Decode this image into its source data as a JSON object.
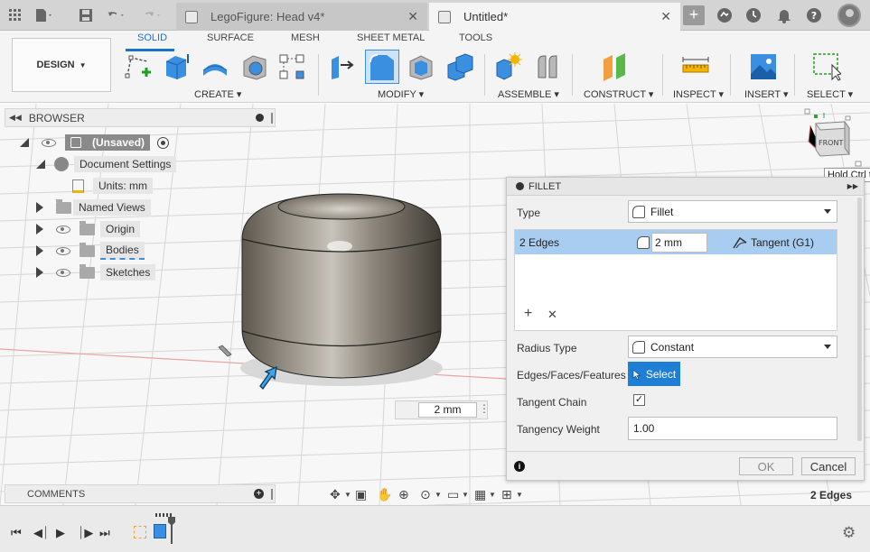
{
  "tabs": [
    {
      "label": "LegoFigure: Head v4*",
      "active": false
    },
    {
      "label": "Untitled*",
      "active": true
    }
  ],
  "toolbar": {
    "design_label": "DESIGN",
    "workspaces": [
      "SOLID",
      "SURFACE",
      "MESH",
      "SHEET METAL",
      "TOOLS"
    ],
    "groups": [
      "CREATE",
      "MODIFY",
      "ASSEMBLE",
      "CONSTRUCT",
      "INSPECT",
      "INSERT",
      "SELECT"
    ]
  },
  "browser": {
    "title": "BROWSER",
    "items": [
      {
        "label": "(Unsaved)"
      },
      {
        "label": "Document Settings"
      },
      {
        "label": "Units: mm"
      },
      {
        "label": "Named Views"
      },
      {
        "label": "Origin"
      },
      {
        "label": "Bodies"
      },
      {
        "label": "Sketches"
      }
    ]
  },
  "comments": {
    "label": "COMMENTS"
  },
  "viewcube": {
    "face_label": "FRONT",
    "tooltip": "Hold Ctrl t"
  },
  "dialog": {
    "title": "FILLET",
    "type_label": "Type",
    "type_value": "Fillet",
    "edges_label": "2 Edges",
    "edges_radius": "2 mm",
    "edges_continuity": "Tangent (G1)",
    "radius_type_label": "Radius Type",
    "radius_type_value": "Constant",
    "faces_label": "Edges/Faces/Features",
    "select_button": "Select",
    "tangent_chain_label": "Tangent Chain",
    "tangent_chain_checked": true,
    "tangency_weight_label": "Tangency Weight",
    "tangency_weight_value": "1.00",
    "ok_label": "OK",
    "cancel_label": "Cancel"
  },
  "viewport_radius": "2 mm",
  "status": {
    "selection": "2 Edges"
  },
  "colors": {
    "accent": "#1f7fd4",
    "highlight_row": "#a9cdf1"
  }
}
